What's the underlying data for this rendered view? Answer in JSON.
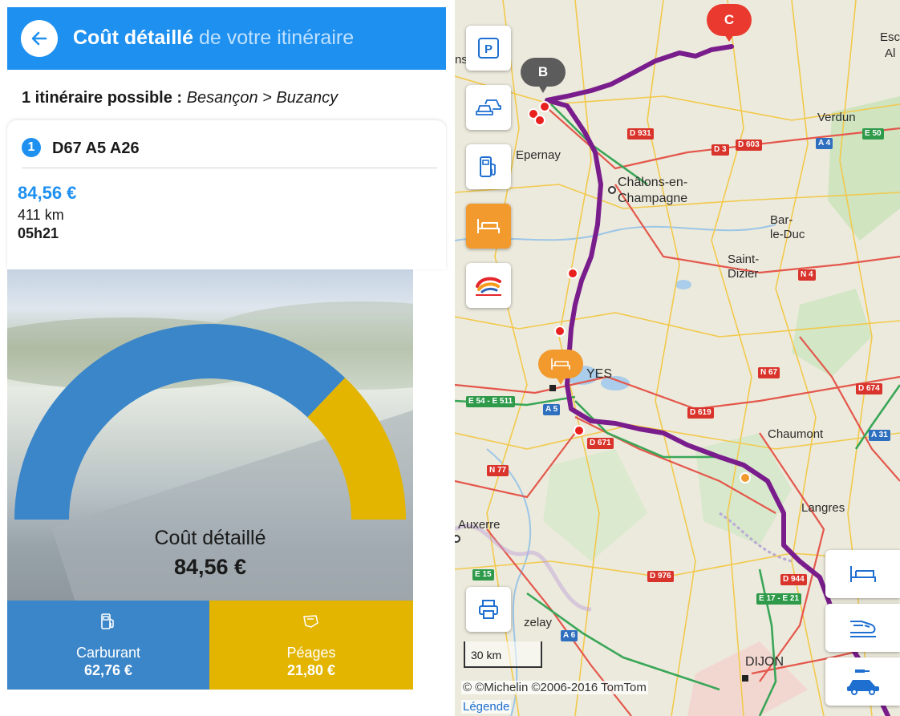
{
  "header": {
    "title_bold": "Coût détaillé",
    "title_light": "de votre itinéraire",
    "back_icon": "arrow-left-icon"
  },
  "summary": {
    "label": "1 itinéraire possible :",
    "route": "Besançon > Buzancy"
  },
  "route": {
    "number": "1",
    "name": "D67 A5 A26",
    "cost": "84,56 €",
    "distance": "411 km",
    "duration": "05h21"
  },
  "gauge": {
    "label": "Coût détaillé",
    "total": "84,56 €",
    "fuel_fraction": 0.742,
    "fuel_color": "#3b86c9",
    "toll_color": "#e3b400"
  },
  "tiles": {
    "fuel": {
      "label": "Carburant",
      "value": "62,76 €",
      "icon": "fuel-pump-icon"
    },
    "tolls": {
      "label": "Péages",
      "value": "21,80 €",
      "icon": "toll-ticket-icon"
    }
  },
  "map": {
    "cities": {
      "epernay": "Epernay",
      "chalons1": "Châlons-en-",
      "chalons2": "Champagne",
      "bar1": "Bar-",
      "bar2": "le-Duc",
      "saint1": "Saint-",
      "saint2": "Dizier",
      "verdun": "Verdun",
      "troyes": "YES",
      "chaumont": "Chaumont",
      "langres": "Langres",
      "auxerre": "Auxerre",
      "dijon": "DIJON",
      "vezelay": "zelay",
      "esc1": "Esc",
      "esc2": "Al",
      "ns": "ns"
    },
    "roads": {
      "a4": "A 4",
      "e50": "E 50",
      "d3": "D 3",
      "d603": "D 603",
      "d931": "D 931",
      "n4": "N 4",
      "d674": "D 674",
      "n67": "N 67",
      "d619": "D 619",
      "e54": "E 54 - E 511",
      "a5": "A 5",
      "d671": "D 671",
      "a31": "A 31",
      "e17": "E 17 - E 21",
      "a6": "A 6",
      "n77": "N 77",
      "e15": "E 15",
      "d976": "D 976",
      "d944": "D 944"
    },
    "pins": {
      "b": "B",
      "c": "C"
    },
    "controls_left": [
      "parking-icon",
      "car-traffic-icon",
      "fuel-station-icon",
      "hotel-bed-icon",
      "totalenergies-logo"
    ],
    "controls_right": [
      "hotel-bed-icon",
      "train-icon",
      "car-rental-icon"
    ],
    "print_icon": "printer-icon",
    "scale": "30 km",
    "copyright": "© ©Michelin ©2006-2016 TomTom",
    "legend": "Légende",
    "route_color": "#7a1d8c"
  }
}
